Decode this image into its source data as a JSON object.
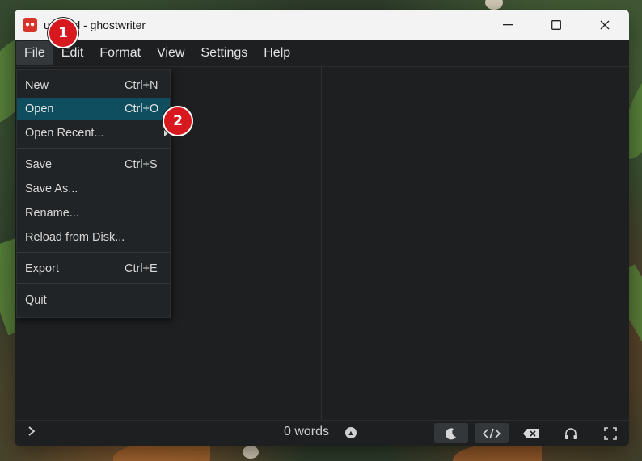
{
  "window": {
    "title": "untitled - ghostwriter"
  },
  "menubar": {
    "items": [
      "File",
      "Edit",
      "Format",
      "View",
      "Settings",
      "Help"
    ]
  },
  "file_menu": {
    "items": [
      {
        "label": "New",
        "shortcut": "Ctrl+N"
      },
      {
        "label": "Open",
        "shortcut": "Ctrl+O"
      },
      {
        "label": "Open Recent...",
        "shortcut": ""
      },
      {
        "label": "Save",
        "shortcut": "Ctrl+S"
      },
      {
        "label": "Save As...",
        "shortcut": ""
      },
      {
        "label": "Rename...",
        "shortcut": ""
      },
      {
        "label": "Reload from Disk...",
        "shortcut": ""
      },
      {
        "label": "Export",
        "shortcut": "Ctrl+E"
      },
      {
        "label": "Quit",
        "shortcut": ""
      }
    ],
    "highlighted": "Open"
  },
  "statusbar": {
    "word_count": "0 words"
  },
  "annotations": {
    "badge1": "1",
    "badge2": "2"
  },
  "colors": {
    "highlight": "#0e4e5f",
    "badge": "#d7191f"
  }
}
